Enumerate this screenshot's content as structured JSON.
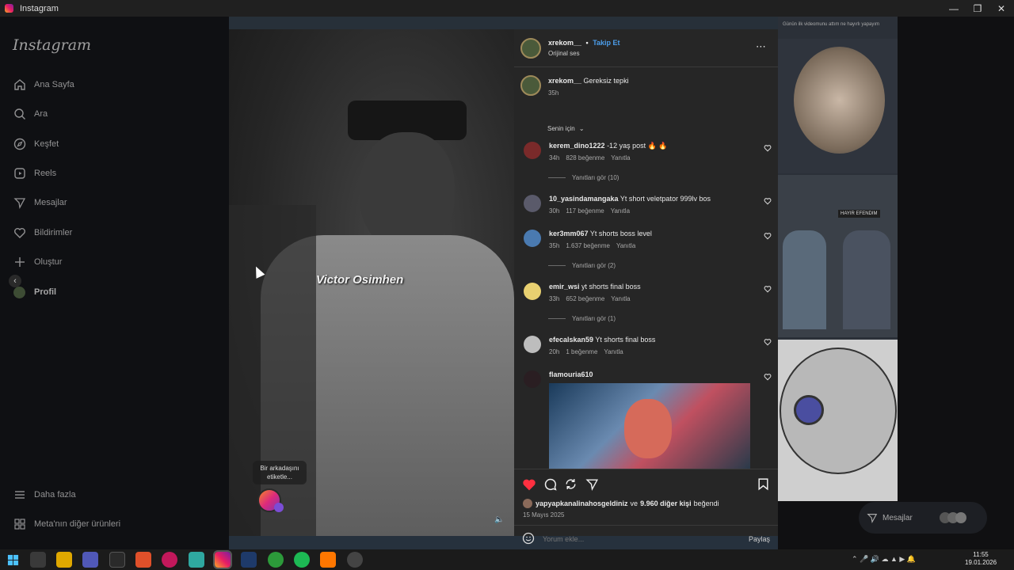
{
  "window": {
    "title": "Instagram",
    "controls": [
      "minimize",
      "restore",
      "close"
    ]
  },
  "sidebar": {
    "logo": "Instagram",
    "items": [
      {
        "label": "Ana Sayfa",
        "icon": "home-icon"
      },
      {
        "label": "Ara",
        "icon": "search-icon"
      },
      {
        "label": "Keşfet",
        "icon": "compass-icon"
      },
      {
        "label": "Reels",
        "icon": "reels-icon"
      },
      {
        "label": "Mesajlar",
        "icon": "messenger-icon"
      },
      {
        "label": "Bildirimler",
        "icon": "heart-icon"
      },
      {
        "label": "Oluştur",
        "icon": "plus-icon"
      },
      {
        "label": "Profil",
        "icon": "profile-avatar"
      }
    ],
    "bottom": [
      {
        "label": "Daha fazla",
        "icon": "menu-icon"
      },
      {
        "label": "Meta'nın diğer ürünleri",
        "icon": "grid-icon"
      }
    ]
  },
  "video": {
    "overlay_text": "Victor Osimhen",
    "tag_tooltip": "Bir arkadaşını etiketle...",
    "sound_icon": "speaker-icon"
  },
  "post": {
    "username": "xrekom__",
    "separator": "•",
    "follow_label": "Takip Et",
    "audio": "Orijinal ses",
    "more_icon": "more-icon",
    "caption_user": "xrekom__",
    "caption_text": "Gereksiz tepki",
    "caption_time": "35h",
    "sort_label": "Senin için",
    "comments": [
      {
        "user": "kerem_dino1222",
        "text": "-12 yaş post 🔥 🔥",
        "time": "34h",
        "likes": "828 beğenme",
        "reply": "Yanıtla",
        "replies": "Yanıtları gör (10)"
      },
      {
        "user": "10_yasindamangaka",
        "text": "Yt short veletpator 999lv bos",
        "time": "30h",
        "likes": "117 beğenme",
        "reply": "Yanıtla",
        "replies": ""
      },
      {
        "user": "ker3mm067",
        "text": "Yt shorts boss level",
        "time": "35h",
        "likes": "1.637 beğenme",
        "reply": "Yanıtla",
        "replies": "Yanıtları gör (2)"
      },
      {
        "user": "emir_wsi",
        "text": "yt shorts final boss",
        "time": "33h",
        "likes": "652 beğenme",
        "reply": "Yanıtla",
        "replies": "Yanıtları gör (1)"
      },
      {
        "user": "efecalskan59",
        "text": "Yt shorts final boss",
        "time": "20h",
        "likes": "1 beğenme",
        "reply": "Yanıtla",
        "replies": ""
      },
      {
        "user": "flamouria610",
        "text": "",
        "time": "",
        "likes": "",
        "reply": "",
        "replies": ""
      }
    ],
    "liked_by_user": "yapyapkanalinahosgeldiniz",
    "liked_by_mid": "ve",
    "liked_by_count": "9.960 diğer kişi",
    "liked_by_suffix": "beğendi",
    "date": "15 Mayıs 2025",
    "comment_placeholder": "Yorum ekle...",
    "share_label": "Paylaş"
  },
  "right_column": {
    "top_caption": "Günün ilk videomunu attım ne hayırlı yapayım",
    "meme_label": "HAYIR EFENDIM"
  },
  "messages_button": {
    "label": "Mesajlar"
  },
  "taskbar": {
    "time": "11:55",
    "date": "19.01.2026"
  },
  "colors": {
    "accent": "#4c9eeb",
    "like": "#ff3040",
    "panel": "#262626",
    "sidebar": "#0f1014"
  }
}
